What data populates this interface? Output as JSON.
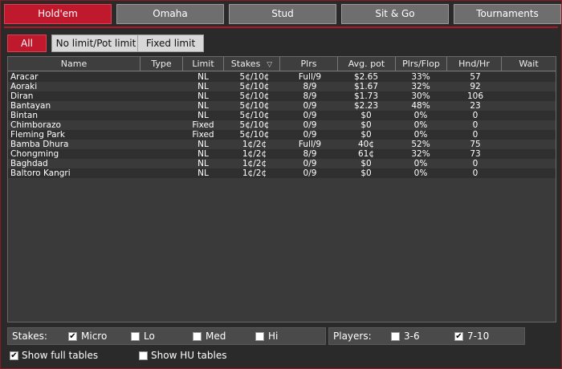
{
  "tabs": [
    "Hold'em",
    "Omaha",
    "Stud",
    "Sit & Go",
    "Tournaments"
  ],
  "filters": [
    "All",
    "No limit/Pot limit",
    "Fixed limit"
  ],
  "columns": [
    "Name",
    "Type",
    "Limit",
    "Stakes",
    "Plrs",
    "Avg. pot",
    "Plrs/Flop",
    "Hnd/Hr",
    "Wait"
  ],
  "rows": [
    {
      "name": "Aracar",
      "limit": "NL",
      "stakes": "5¢/10¢",
      "plrs": "Full/9",
      "avg": "$2.65",
      "flop": "33%",
      "hnd": "57"
    },
    {
      "name": "Aoraki",
      "limit": "NL",
      "stakes": "5¢/10¢",
      "plrs": "8/9",
      "avg": "$1.67",
      "flop": "32%",
      "hnd": "92"
    },
    {
      "name": "Diran",
      "limit": "NL",
      "stakes": "5¢/10¢",
      "plrs": "8/9",
      "avg": "$1.73",
      "flop": "30%",
      "hnd": "106"
    },
    {
      "name": "Bantayan",
      "limit": "NL",
      "stakes": "5¢/10¢",
      "plrs": "0/9",
      "avg": "$2.23",
      "flop": "48%",
      "hnd": "23"
    },
    {
      "name": "Bintan",
      "limit": "NL",
      "stakes": "5¢/10¢",
      "plrs": "0/9",
      "avg": "$0",
      "flop": "0%",
      "hnd": "0"
    },
    {
      "name": "Chimborazo",
      "limit": "Fixed",
      "stakes": "5¢/10¢",
      "plrs": "0/9",
      "avg": "$0",
      "flop": "0%",
      "hnd": "0"
    },
    {
      "name": "Fleming Park",
      "limit": "Fixed",
      "stakes": "5¢/10¢",
      "plrs": "0/9",
      "avg": "$0",
      "flop": "0%",
      "hnd": "0"
    },
    {
      "name": "Bamba Dhura",
      "limit": "NL",
      "stakes": "1¢/2¢",
      "plrs": "Full/9",
      "avg": "40¢",
      "flop": "52%",
      "hnd": "75"
    },
    {
      "name": "Chongming",
      "limit": "NL",
      "stakes": "1¢/2¢",
      "plrs": "8/9",
      "avg": "61¢",
      "flop": "32%",
      "hnd": "73"
    },
    {
      "name": "Baghdad",
      "limit": "NL",
      "stakes": "1¢/2¢",
      "plrs": "0/9",
      "avg": "$0",
      "flop": "0%",
      "hnd": "0"
    },
    {
      "name": "Baltoro Kangri",
      "limit": "NL",
      "stakes": "1¢/2¢",
      "plrs": "0/9",
      "avg": "$0",
      "flop": "0%",
      "hnd": "0"
    }
  ],
  "stakes": {
    "label": "Stakes:",
    "options": [
      {
        "label": "Micro",
        "checked": true
      },
      {
        "label": "Lo",
        "checked": false
      },
      {
        "label": "Med",
        "checked": false
      },
      {
        "label": "Hi",
        "checked": false
      }
    ]
  },
  "players": {
    "label": "Players:",
    "options": [
      {
        "label": "3-6",
        "checked": false
      },
      {
        "label": "7-10",
        "checked": true
      }
    ]
  },
  "extra": [
    {
      "label": "Show full tables",
      "checked": true
    },
    {
      "label": "Show HU tables",
      "checked": false
    }
  ],
  "check_mark": "✔",
  "sort_icon": "▽",
  "colors": {
    "accent": "#c0182c"
  }
}
